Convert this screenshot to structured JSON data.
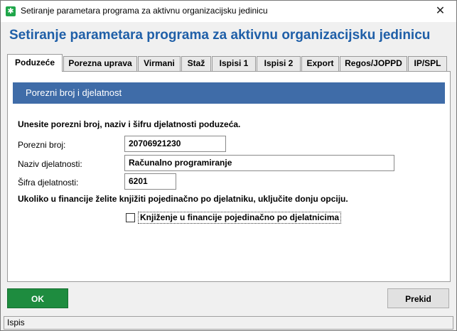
{
  "window": {
    "title": "Setiranje parametara programa za aktivnu organizacijsku jedinicu",
    "close_symbol": "✕"
  },
  "header": {
    "title": "Setiranje parametara programa za aktivnu organizacijsku jedinicu"
  },
  "tabs": [
    {
      "label": "Poduzeće",
      "active": true
    },
    {
      "label": "Porezna uprava",
      "active": false
    },
    {
      "label": "Virmani",
      "active": false
    },
    {
      "label": "Staž",
      "active": false
    },
    {
      "label": "Ispisi 1",
      "active": false
    },
    {
      "label": "Ispisi 2",
      "active": false
    },
    {
      "label": "Export",
      "active": false
    },
    {
      "label": "Regos/JOPPD",
      "active": false
    },
    {
      "label": "IP/SPL",
      "active": false
    }
  ],
  "section": {
    "title": "Porezni broj i djelatnost",
    "intro": "Unesite porezni broj, naziv i šifru djelatnosti poduzeća."
  },
  "form": {
    "tax_number_label": "Porezni broj:",
    "tax_number_value": "20706921230",
    "activity_name_label": "Naziv djelatnosti:",
    "activity_name_value": "Računalno programiranje",
    "activity_code_label": "Šifra djelatnosti:",
    "activity_code_value": "6201",
    "note": "Ukoliko u financije želite knjižiti pojedinačno po djelatniku, uključite donju opciju.",
    "checkbox_label": "Knjiženje u financije pojedinačno po djelatnicima",
    "checkbox_checked": false
  },
  "buttons": {
    "ok": "OK",
    "cancel": "Prekid"
  },
  "status": {
    "text": "Ispis"
  },
  "colors": {
    "header_blue": "#1f5fa8",
    "section_bar": "#3f6ca8",
    "ok_green": "#1e8c3f"
  },
  "icons": {
    "app": "app-icon",
    "close": "close-icon"
  }
}
